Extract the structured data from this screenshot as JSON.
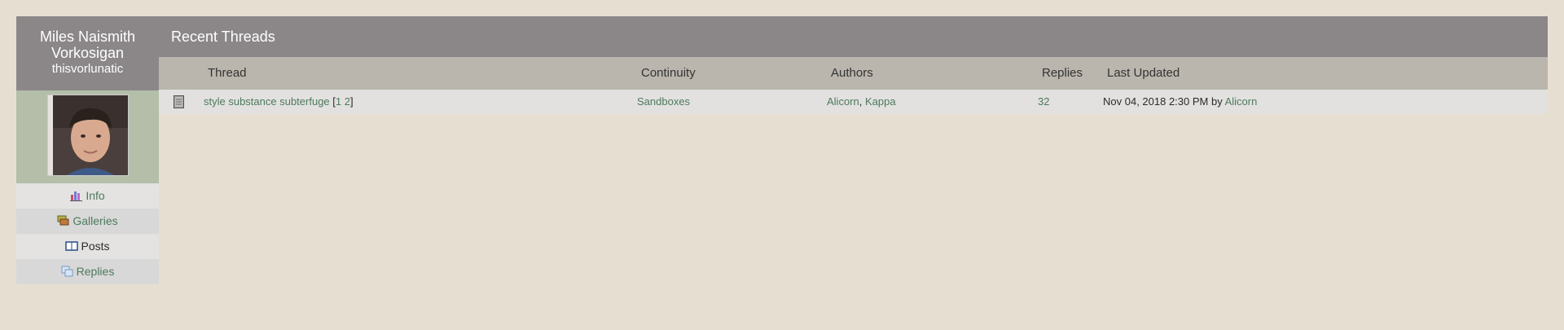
{
  "sidebar": {
    "display_name_line1": "Miles Naismith",
    "display_name_line2": "Vorkosigan",
    "username": "thisvorlunatic",
    "nav": [
      {
        "label": "Info",
        "icon": "chart-icon"
      },
      {
        "label": "Galleries",
        "icon": "galleries-icon"
      },
      {
        "label": "Posts",
        "icon": "book-icon"
      },
      {
        "label": "Replies",
        "icon": "replies-icon"
      }
    ]
  },
  "main": {
    "title": "Recent Threads",
    "columns": {
      "thread": "Thread",
      "continuity": "Continuity",
      "authors": "Authors",
      "replies": "Replies",
      "last_updated": "Last Updated"
    },
    "rows": [
      {
        "thread": "style substance subterfuge",
        "page_open": "[",
        "page1": "1",
        "page2": "2",
        "page_close": "]",
        "continuity": "Sandboxes",
        "author1": "Alicorn",
        "author_sep": ",",
        "author2": "Kappa",
        "replies": "32",
        "last_updated": "Nov 04, 2018 2:30 PM by",
        "last_updated_by": "Alicorn"
      }
    ]
  },
  "colors": {
    "background": "#e6dfd1",
    "header": "#8b8788",
    "link": "#4d7a5e",
    "column_header": "#bab6ad"
  }
}
